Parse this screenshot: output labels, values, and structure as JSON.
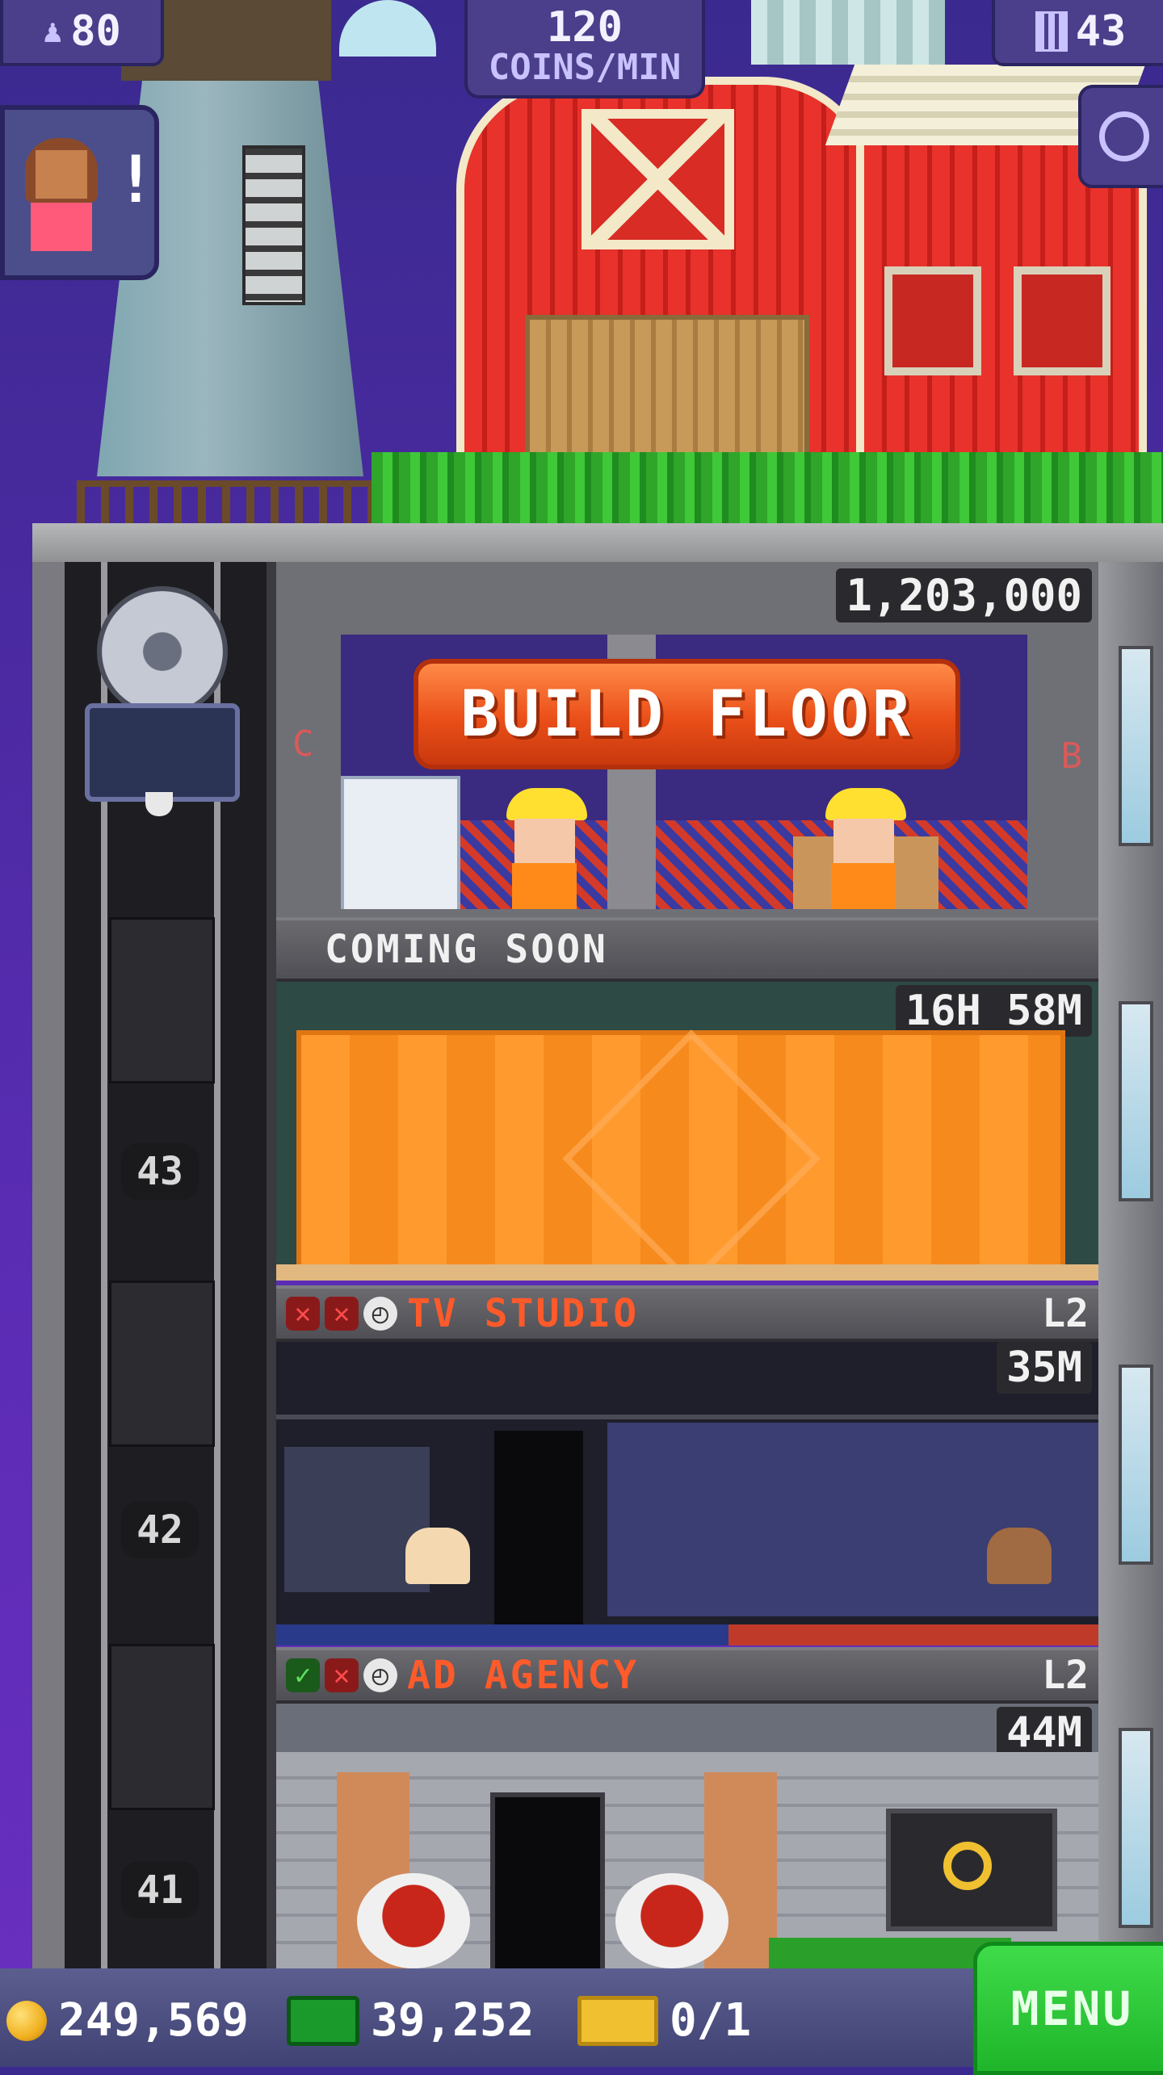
{
  "top_bar": {
    "population": "80",
    "coins_per_min_value": "120",
    "coins_per_min_label": "COINS/MIN",
    "floors": "43"
  },
  "icons": {
    "population": "person-icon",
    "floors": "building-icon",
    "zoom": "magnifier-icon",
    "notification": "exclamation-icon"
  },
  "build_floor": {
    "cost": "1,203,000",
    "button_label": "BUILD FLOOR"
  },
  "coming_soon": {
    "label": "COMING SOON",
    "timer": "16H 58M"
  },
  "floors": [
    {
      "name": "TV STUDIO",
      "level": "L2",
      "timer": "35M",
      "elevator_number": "42",
      "status": [
        "x",
        "x",
        "clock"
      ]
    },
    {
      "name": "AD AGENCY",
      "level": "L2",
      "timer": "44M",
      "elevator_number": "41",
      "status": [
        "ok",
        "x",
        "clock"
      ]
    }
  ],
  "elevator": {
    "construction_floor_number": "43"
  },
  "side_labels": {
    "left": "C",
    "right": "B"
  },
  "bottom_bar": {
    "coins": "249,569",
    "bux": "39,252",
    "tickets": "0/1",
    "menu_label": "MENU"
  },
  "colors": {
    "accent_orange": "#ea4f18",
    "menu_green": "#1fb52a",
    "floor_name_orange": "#ff5a2a"
  }
}
